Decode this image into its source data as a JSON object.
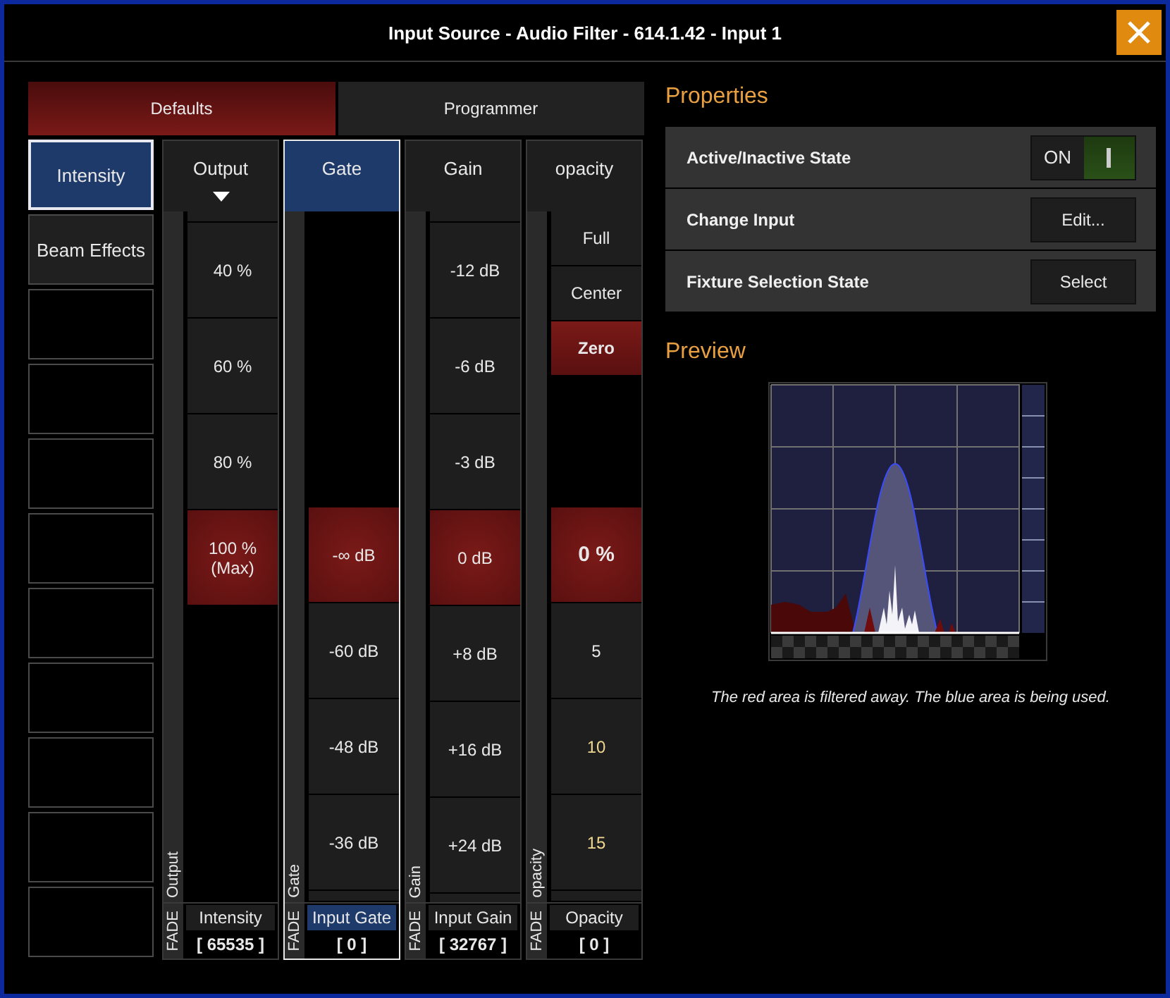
{
  "window": {
    "title": "Input Source - Audio Filter - 614.1.42 - Input 1"
  },
  "tabs": [
    {
      "label": "Defaults",
      "selected": true
    },
    {
      "label": "Programmer",
      "selected": false
    }
  ],
  "presets": [
    {
      "label": "Intensity",
      "selected": true
    },
    {
      "label": "Beam Effects",
      "selected": false
    },
    {
      "selected": false
    },
    {
      "selected": false
    },
    {
      "selected": false
    },
    {
      "selected": false
    },
    {
      "selected": false
    },
    {
      "selected": false
    },
    {
      "selected": false
    },
    {
      "selected": false
    },
    {
      "selected": false
    }
  ],
  "faders": [
    {
      "title": "Output",
      "selected": false,
      "dropdown": true,
      "strip_label": "Output",
      "fade": "FADE",
      "name": "Intensity",
      "value": "[ 65535 ]",
      "items": [
        {
          "kind": "step",
          "label": "40 %",
          "selected": false
        },
        {
          "kind": "step",
          "label": "60 %",
          "selected": false
        },
        {
          "kind": "step",
          "label": "80 %",
          "selected": false
        },
        {
          "kind": "step",
          "label": "100 %\n(Max)",
          "selected": true
        },
        {
          "kind": "blank"
        }
      ]
    },
    {
      "title": "Gate",
      "selected": true,
      "dropdown": false,
      "strip_label": "Gate",
      "fade": "FADE",
      "name": "Input Gate",
      "value": "[ 0 ]",
      "items": [
        {
          "kind": "blank"
        },
        {
          "kind": "step",
          "label": "-∞ dB",
          "selected": true
        },
        {
          "kind": "step",
          "label": "-60 dB",
          "selected": false
        },
        {
          "kind": "step",
          "label": "-48 dB",
          "selected": false
        },
        {
          "kind": "step",
          "label": "-36 dB",
          "selected": false
        }
      ]
    },
    {
      "title": "Gain",
      "selected": false,
      "dropdown": false,
      "strip_label": "Gain",
      "fade": "FADE",
      "name": "Input Gain",
      "value": "[ 32767 ]",
      "items": [
        {
          "kind": "step",
          "label": "-12 dB",
          "selected": false
        },
        {
          "kind": "step",
          "label": "-6 dB",
          "selected": false
        },
        {
          "kind": "step",
          "label": "-3 dB",
          "selected": false
        },
        {
          "kind": "step",
          "label": "0 dB",
          "selected": true
        },
        {
          "kind": "step",
          "label": "+8 dB",
          "selected": false
        },
        {
          "kind": "step",
          "label": "+16 dB",
          "selected": false
        },
        {
          "kind": "step",
          "label": "+24 dB",
          "selected": false
        }
      ]
    },
    {
      "title": "opacity",
      "selected": false,
      "dropdown": false,
      "strip_label": "opacity",
      "fade": "FADE",
      "name": "Opacity",
      "value": "[ 0 ]",
      "items": [
        {
          "kind": "preset",
          "label": "Full",
          "selected": false
        },
        {
          "kind": "preset",
          "label": "Center",
          "selected": false
        },
        {
          "kind": "preset",
          "label": "Zero",
          "selected": true
        },
        {
          "kind": "blank"
        },
        {
          "kind": "step",
          "label": "0 %",
          "selected": true,
          "bold": true,
          "highlighted": false
        },
        {
          "kind": "step",
          "label": "5",
          "selected": false,
          "bold": false,
          "highlighted": false
        },
        {
          "kind": "step",
          "label": "10",
          "selected": false,
          "bold": false,
          "highlighted": true
        },
        {
          "kind": "step",
          "label": "15",
          "selected": false,
          "bold": false,
          "highlighted": true
        }
      ]
    }
  ],
  "properties": {
    "title": "Properties",
    "rows": [
      {
        "label": "Active/Inactive State",
        "kind": "toggle",
        "value": "ON",
        "on": true
      },
      {
        "label": "Change Input",
        "kind": "button",
        "value": "Edit..."
      },
      {
        "label": "Fixture Selection State",
        "kind": "button",
        "value": "Select"
      }
    ]
  },
  "preview": {
    "title": "Preview",
    "caption": "The red area is filtered away. The blue area is being used."
  }
}
